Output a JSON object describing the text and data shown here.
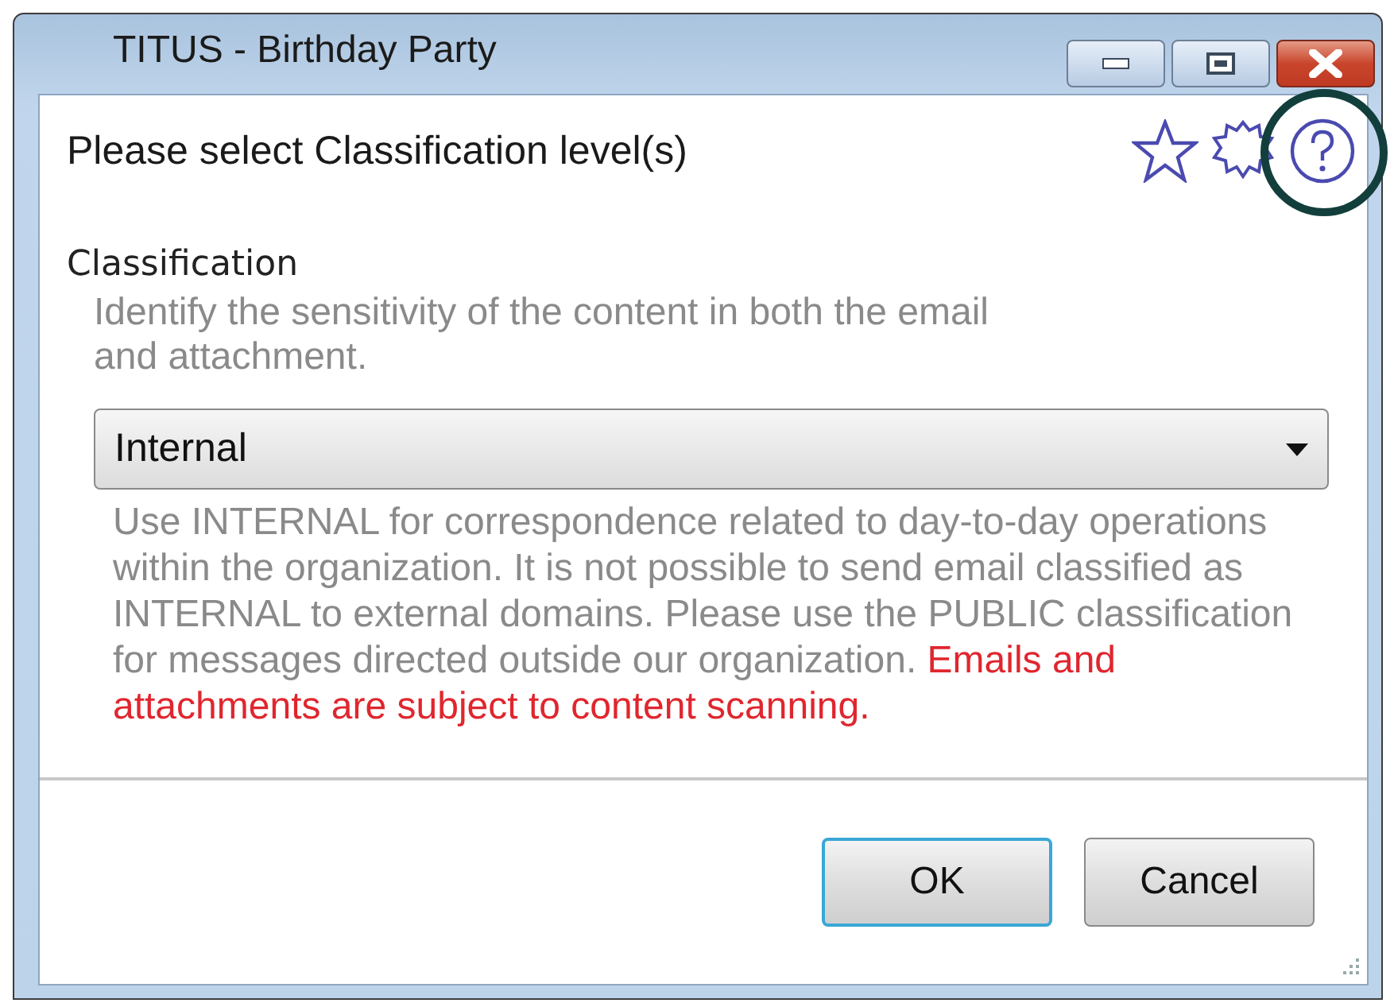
{
  "window": {
    "title": "TITUS - Birthday Party"
  },
  "header": {
    "prompt": "Please select Classification level(s)",
    "icons": [
      {
        "kind": "star",
        "highlighted": false
      },
      {
        "kind": "gear",
        "highlighted": false
      },
      {
        "kind": "help",
        "highlighted": true
      }
    ]
  },
  "classification": {
    "label": "Classification",
    "hint": "Identify the sensitivity of the content in both the email and attachment.",
    "value": "Internal",
    "description": "Use INTERNAL for correspondence related to day-to-day operations within the organization. It is not possible to send email classified as INTERNAL to external domains. Please use the PUBLIC classification for messages directed outside our organization.",
    "warning": "Emails and attachments are subject to content scanning."
  },
  "buttons": [
    {
      "label": "OK",
      "default": true
    },
    {
      "label": "Cancel",
      "default": false
    }
  ]
}
